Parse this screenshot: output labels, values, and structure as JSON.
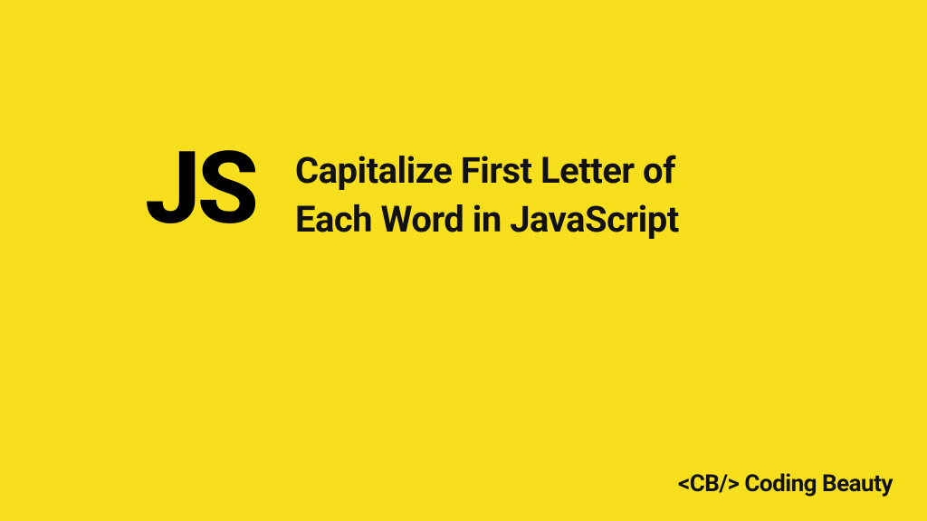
{
  "badge": "JS",
  "title": "Capitalize First Letter of Each Word in JavaScript",
  "footer": "<CB/> Coding Beauty",
  "colors": {
    "background": "#F7DF1E",
    "text": "#111111"
  }
}
